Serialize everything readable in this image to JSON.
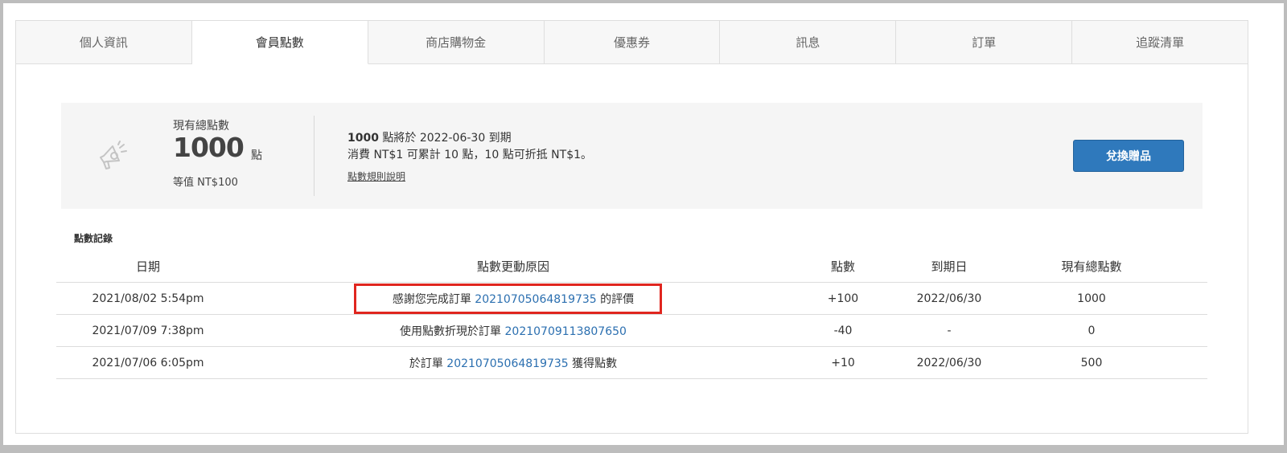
{
  "tabs": [
    {
      "label": "個人資訊",
      "active": false
    },
    {
      "label": "會員點數",
      "active": true
    },
    {
      "label": "商店購物金",
      "active": false
    },
    {
      "label": "優惠券",
      "active": false
    },
    {
      "label": "訊息",
      "active": false
    },
    {
      "label": "訂單",
      "active": false
    },
    {
      "label": "追蹤清單",
      "active": false
    }
  ],
  "summary": {
    "icon": "megaphone-icon",
    "total_label": "現有總點數",
    "total_value": "1000",
    "total_unit": "點",
    "equivalent": "等值 NT$100",
    "expire_points": "1000",
    "expire_text": " 點將於 2022-06-30 到期",
    "rate_text": "消費 NT$1 可累計 10 點，10 點可折抵 NT$1。",
    "rules_link": "點數規則說明",
    "redeem_button": "兌換贈品"
  },
  "records": {
    "title": "點數記錄",
    "headers": {
      "date": "日期",
      "reason": "點數更動原因",
      "points": "點數",
      "expiry": "到期日",
      "total": "現有總點數"
    },
    "rows": [
      {
        "date": "2021/08/02 5:54pm",
        "reason_prefix": "感謝您完成訂單 ",
        "order": "20210705064819735",
        "reason_suffix": " 的評價",
        "points": "+100",
        "expiry": "2022/06/30",
        "total": "1000"
      },
      {
        "date": "2021/07/09 7:38pm",
        "reason_prefix": "使用點數折現於訂單 ",
        "order": "20210709113807650",
        "reason_suffix": "",
        "points": "-40",
        "expiry": "-",
        "total": "0"
      },
      {
        "date": "2021/07/06 6:05pm",
        "reason_prefix": "於訂單 ",
        "order": "20210705064819735",
        "reason_suffix": " 獲得點數",
        "points": "+10",
        "expiry": "2022/06/30",
        "total": "500"
      }
    ]
  },
  "colors": {
    "accent": "#2f79bc",
    "link": "#2b6fb0",
    "positive": "#5cb85c",
    "negative": "#d9534f",
    "highlight": "#e0261f"
  }
}
